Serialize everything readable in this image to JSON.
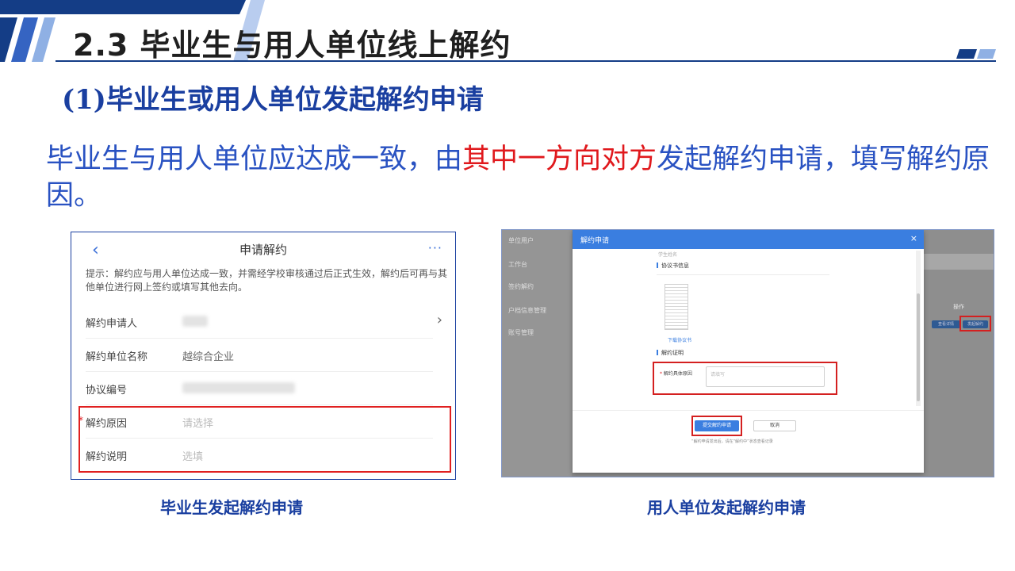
{
  "slide": {
    "title": "2.3 毕业生与用人单位线上解约",
    "subtitle_num": "(1)",
    "subtitle_text": "毕业生或用人单位发起解约申请",
    "body_part1": "毕业生与用人单位应达成一致，由",
    "body_highlight": "其中一方向对方",
    "body_part2": "发起解约申请，填写解约原因。",
    "colors": {
      "primary": "#1a3fa0",
      "body": "#2952c2",
      "highlight": "#e0191d",
      "dark_blue": "#143d86"
    }
  },
  "mobile": {
    "back_icon": "chevron-left-icon",
    "title": "申请解约",
    "more_icon": "more-dots-icon",
    "more_glyph": "···",
    "tip": "提示：解约应与用人单位达成一致，并需经学校审核通过后正式生效，解约后可再与其他单位进行网上签约或填写其他去向。",
    "rows": [
      {
        "label": "解约申请人",
        "value": "",
        "chevron": "›"
      },
      {
        "label": "解约单位名称",
        "value": "越综合企业"
      },
      {
        "label": "协议编号",
        "value": ""
      },
      {
        "label": "解约原因",
        "placeholder": "请选择",
        "required": "*"
      },
      {
        "label": "解约说明",
        "placeholder": "选填"
      }
    ],
    "caption": "毕业生发起解约申请"
  },
  "desktop": {
    "sidebar": {
      "top": "单位用户",
      "items": [
        "工作台",
        "签约解约",
        "户档信息管理",
        "账号管理"
      ]
    },
    "table_op_header": "操作",
    "table_btn1": "查看详情",
    "table_btn2": "发起解约",
    "modal": {
      "title": "解约申请",
      "close": "×",
      "faint_text": "学生姓名",
      "section1": "协议书信息",
      "download_link": "下载协议书",
      "section2": "解约证明",
      "field_required": "*",
      "field_label": "解约具体原因",
      "field_placeholder": "请填写",
      "submit_label": "提交解约申请",
      "cancel_label": "取消",
      "note": "“解约申请发出后，请在“解约中”状态查看记录"
    },
    "caption": "用人单位发起解约申请"
  }
}
